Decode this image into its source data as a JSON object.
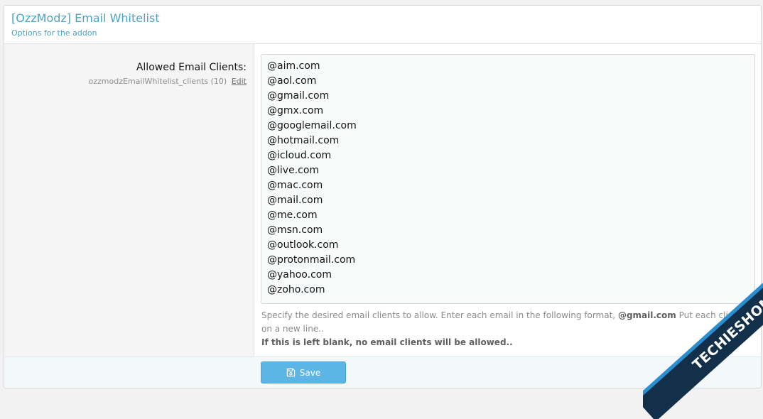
{
  "header": {
    "title": "[OzzModz] Email Whitelist",
    "subtitle": "Options for the addon"
  },
  "option": {
    "label": "Allowed Email Clients:",
    "hint_id": "ozzmodzEmailWhitelist_clients (10)",
    "edit_label": "Edit",
    "value_lines": [
      "@aim.com",
      "@aol.com",
      "@gmail.com",
      "@gmx.com",
      "@googlemail.com",
      "@hotmail.com",
      "@icloud.com",
      "@live.com",
      "@mac.com",
      "@mail.com",
      "@me.com",
      "@msn.com",
      "@outlook.com",
      "@protonmail.com",
      "@yahoo.com",
      "@zoho.com"
    ],
    "explain_prefix": "Specify the desired email clients to allow. Enter each email in the following format,",
    "explain_example": "@gmail.com",
    "explain_suffix": "Put each client on a new line..",
    "explain_warning": "If this is left blank, no email clients will be allowed.."
  },
  "footer": {
    "save_label": "Save"
  },
  "watermark": {
    "text": "TECHIESHOME.COM"
  },
  "colors": {
    "accent": "#4aa3c7",
    "button": "#5db5e6",
    "watermark_dark": "#12304a",
    "watermark_light": "#2a8fd0"
  },
  "icons": {
    "save": "floppy-disk-icon"
  }
}
